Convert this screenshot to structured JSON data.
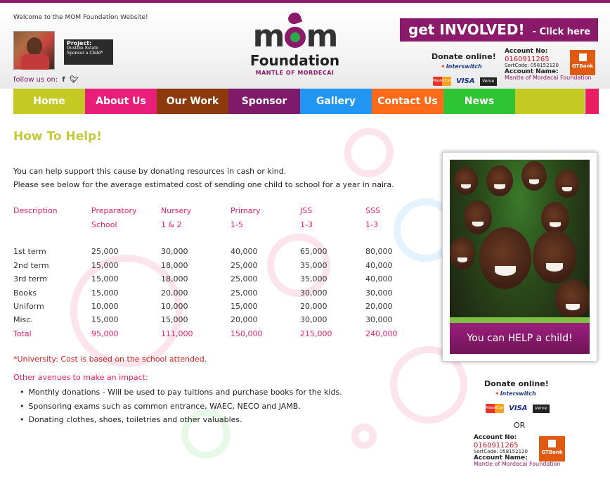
{
  "header": {
    "welcome": "Welcome to the MOM Foundation Website!",
    "project": {
      "title": "Project:",
      "line1": "Dustbin Estate",
      "line2": "Sponsor a Child*"
    },
    "follow_label": "follow us on:",
    "social": [
      "f",
      "t"
    ]
  },
  "logo": {
    "mom": "mom",
    "foundation": "Foundation",
    "tagline": "MANTLE OF MORDECAI"
  },
  "involve": {
    "title": "get INVOLVED!",
    "click": "- Click here"
  },
  "donate": {
    "heading": "Donate online!",
    "interswitch": "Interswitch",
    "mastercard": "MasterCard",
    "visa": "VISA",
    "verve": "Verve",
    "account_label": "Account No:",
    "account_number": "0160911265",
    "sort_code": "SortCode: 058152120",
    "account_name_label": "Account Name:",
    "account_name": "Mantle of Mordecai Foundation",
    "bank": "GTBank",
    "or": "OR"
  },
  "nav": [
    {
      "label": "Home",
      "color": "#c5ca22"
    },
    {
      "label": "About Us",
      "color": "#e91e7a"
    },
    {
      "label": "Our Work",
      "color": "#8c3a0c"
    },
    {
      "label": "Sponsor",
      "color": "#7f1a6a"
    },
    {
      "label": "Gallery",
      "color": "#2196f3"
    },
    {
      "label": "Contact Us",
      "color": "#ff6b1a"
    },
    {
      "label": "News",
      "color": "#2ec434"
    },
    {
      "label": "",
      "color": "#c5ca22"
    }
  ],
  "content": {
    "heading": "How To Help!",
    "intro1": "You can help support this cause by donating resources in cash or kind.",
    "intro2": "Please see below for the average estimated cost of sending one child to school for a year in naira.",
    "table": {
      "headers_row1": [
        "Description",
        "Preparatory",
        "Nursery",
        "Primary",
        "JSS",
        "SSS"
      ],
      "headers_row2": [
        "",
        "School",
        "1 & 2",
        "1-5",
        "1-3",
        "1-3"
      ],
      "rows": [
        [
          "1st term",
          "25,000",
          "30,000",
          "40,000",
          "65,000",
          "80,000"
        ],
        [
          "2nd term",
          "15,000",
          "18,000",
          "25,000",
          "35,000",
          "40,000"
        ],
        [
          "3rd term",
          "15,000",
          "18,000",
          "25,000",
          "35,000",
          "40,000"
        ],
        [
          "Books",
          "15,000",
          "20,000",
          "25,000",
          "30,000",
          "30,000"
        ],
        [
          "Uniform",
          "10,000",
          "10,000",
          "15,000",
          "20,000",
          "20,000"
        ],
        [
          "Misc.",
          "15,000",
          "15,000",
          "20,000",
          "30,000",
          "30,000"
        ]
      ],
      "total": [
        "Total",
        "95,000",
        "111,000",
        "150,000",
        "215,000",
        "240,000"
      ]
    },
    "university_note": "*University: Cost is based on the school attended.",
    "avenues_heading": "Other avenues to make an impact:",
    "avenues": [
      "Monthly donations - Will be used to pay tuitions and purchase books for the kids.",
      "Sponsoring exams such as common entrance, WAEC, NECO and JAMB.",
      "Donating clothes, shoes, toiletries and other valuables."
    ]
  },
  "sidebar": {
    "caption": "You can HELP a child!"
  }
}
